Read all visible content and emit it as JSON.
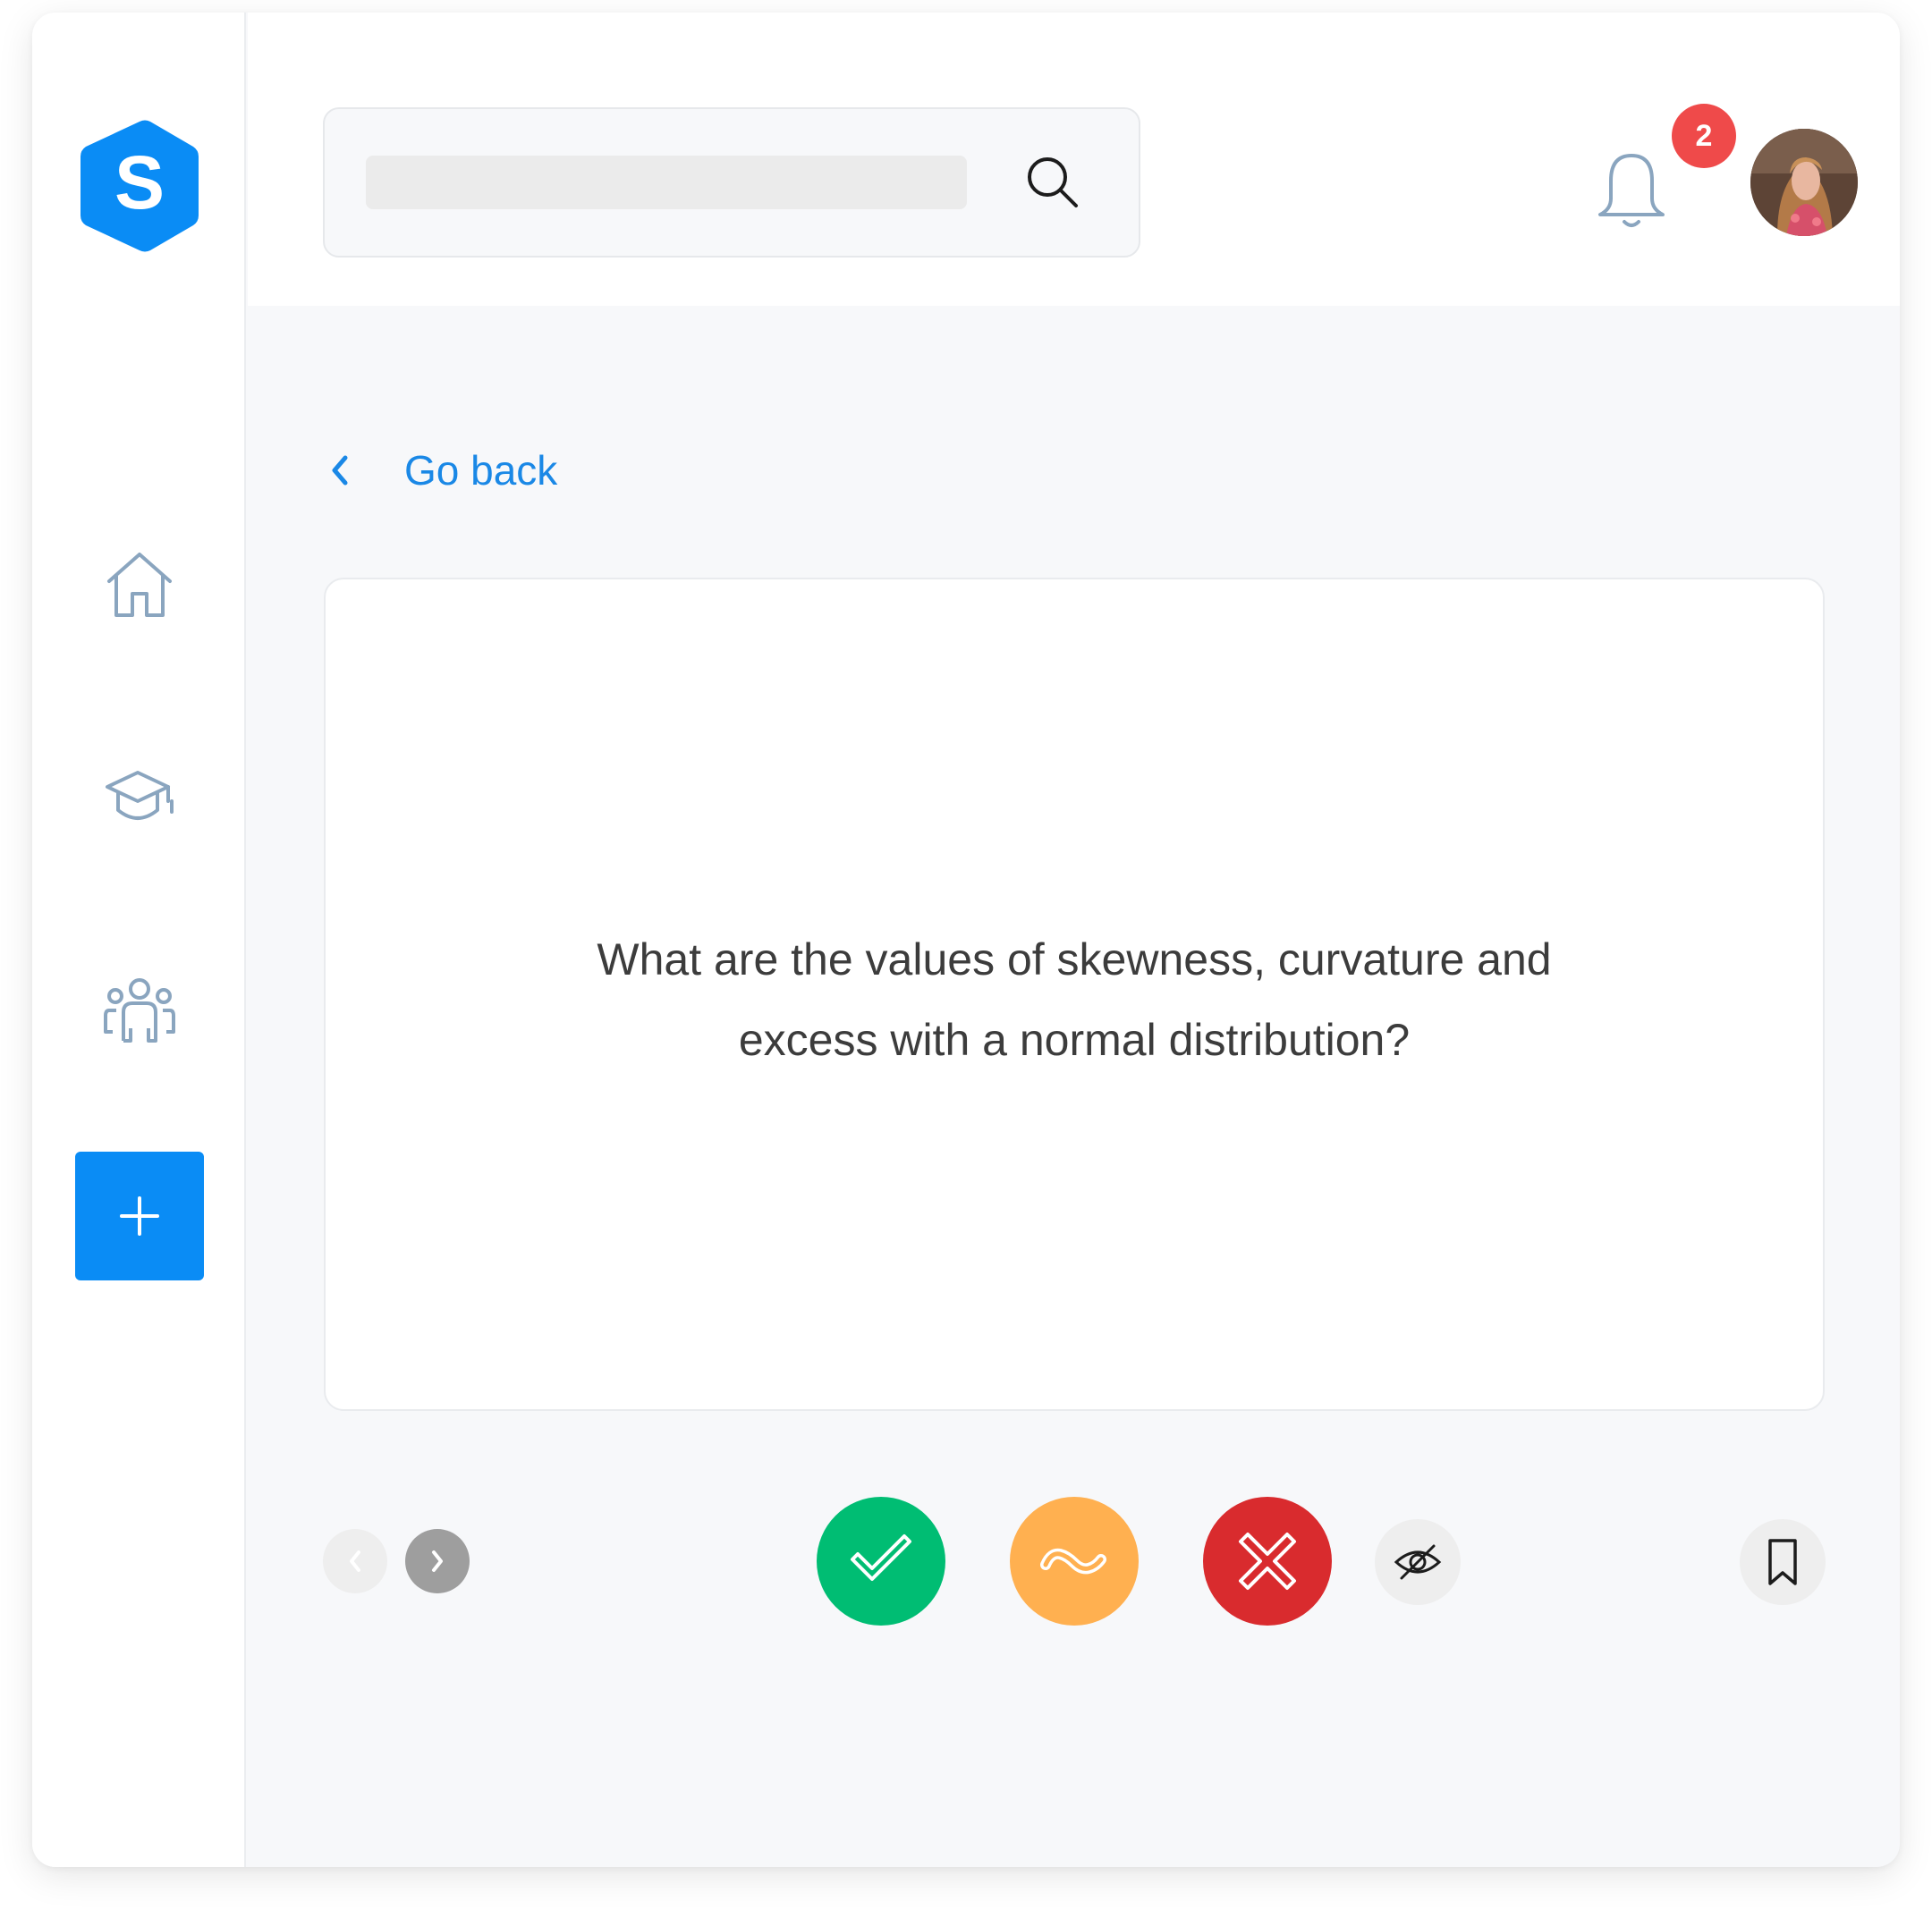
{
  "app": {
    "logo_letter": "S",
    "brand_color": "#0a8cf5"
  },
  "sidebar": {
    "items": [
      {
        "name": "home",
        "icon": "home-icon"
      },
      {
        "name": "courses",
        "icon": "graduation-cap-icon"
      },
      {
        "name": "groups",
        "icon": "users-group-icon"
      }
    ],
    "add_button_icon": "plus-icon"
  },
  "header": {
    "search": {
      "value": "",
      "placeholder": "",
      "icon": "search-icon"
    },
    "notifications": {
      "icon": "bell-icon",
      "count": "2",
      "badge_color": "#ef4a4a"
    },
    "avatar": {
      "icon": "user-avatar"
    }
  },
  "navigation": {
    "go_back_label": "Go back",
    "go_back_icon": "chevron-left-icon"
  },
  "flashcard": {
    "question": "What are the values of skewness, curvature and excess with a normal distribution?"
  },
  "controls": {
    "prev": {
      "icon": "chevron-left-icon",
      "enabled": false
    },
    "next": {
      "icon": "chevron-right-icon",
      "enabled": true
    },
    "answers": [
      {
        "name": "correct",
        "icon": "check-icon",
        "color": "#00bd73"
      },
      {
        "name": "partially-correct",
        "icon": "wave-icon",
        "color": "#ffb050"
      },
      {
        "name": "wrong",
        "icon": "x-icon",
        "color": "#d92b2e"
      }
    ],
    "hide": {
      "icon": "eye-off-icon"
    },
    "bookmark": {
      "icon": "bookmark-icon"
    }
  }
}
